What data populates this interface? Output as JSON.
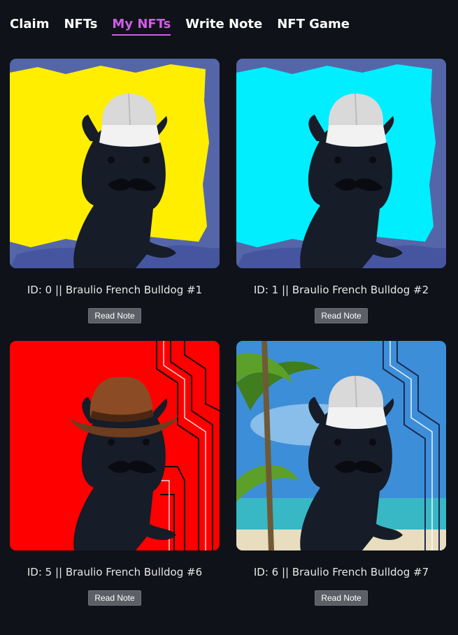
{
  "nav": {
    "items": [
      {
        "label": "Claim",
        "active": false
      },
      {
        "label": "NFTs",
        "active": false
      },
      {
        "label": "My NFTs",
        "active": true
      },
      {
        "label": "Write Note",
        "active": false
      },
      {
        "label": "NFT Game",
        "active": false
      }
    ],
    "active_color": "#cf5fe6"
  },
  "nfts": [
    {
      "caption": "ID: 0 || Braulio French Bulldog #1",
      "button": "Read Note",
      "background": "yellow-paint",
      "bg_color": "#ffee00",
      "hat": "white-cap-icon"
    },
    {
      "caption": "ID: 1 || Braulio French Bulldog #2",
      "button": "Read Note",
      "background": "cyan-paint",
      "bg_color": "#00eeff",
      "hat": "white-cap-icon"
    },
    {
      "caption": "ID: 5 || Braulio French Bulldog #6",
      "button": "Read Note",
      "background": "red-circuit",
      "bg_color": "#ff0000",
      "hat": "cowboy-hat-icon"
    },
    {
      "caption": "ID: 6 || Braulio French Bulldog #7",
      "button": "Read Note",
      "background": "beach-palm-circuit",
      "bg_color": "#3d8ed8",
      "hat": "white-cap-icon"
    }
  ],
  "colors": {
    "page_bg": "#0f1218",
    "button_bg": "#5c5f66"
  }
}
